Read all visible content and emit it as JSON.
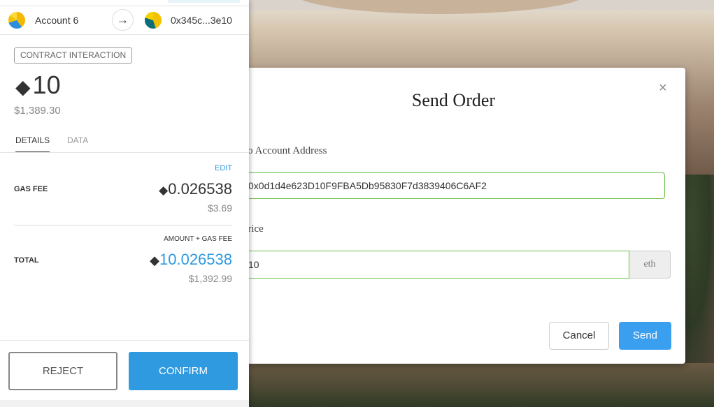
{
  "metamask": {
    "from_account": "Account 6",
    "to_address": "0x345c...3e10",
    "badge": "CONTRACT INTERACTION",
    "eth_symbol": "◆",
    "amount": "10",
    "amount_usd": "$1,389.30",
    "tabs": {
      "details": "DETAILS",
      "data": "DATA"
    },
    "edit": "EDIT",
    "gas_fee_label": "GAS FEE",
    "gas_fee_eth": "0.026538",
    "gas_fee_usd": "$3.69",
    "amount_gas_label": "AMOUNT + GAS FEE",
    "total_label": "TOTAL",
    "total_eth": "10.026538",
    "total_usd": "$1,392.99",
    "reject": "REJECT",
    "confirm": "CONFIRM"
  },
  "modal": {
    "title": "Send Order",
    "close": "×",
    "to_label": "To Account Address",
    "to_value": "0x0d1d4e623D10F9FBA5Db95830F7d3839406C6AF2",
    "price_label": "Price",
    "price_value": "10",
    "price_unit": "eth",
    "cancel": "Cancel",
    "send": "Send"
  },
  "colors": {
    "accent": "#2f9ae0",
    "send_button": "#3b9ff0",
    "valid_border": "#6cc04a"
  }
}
